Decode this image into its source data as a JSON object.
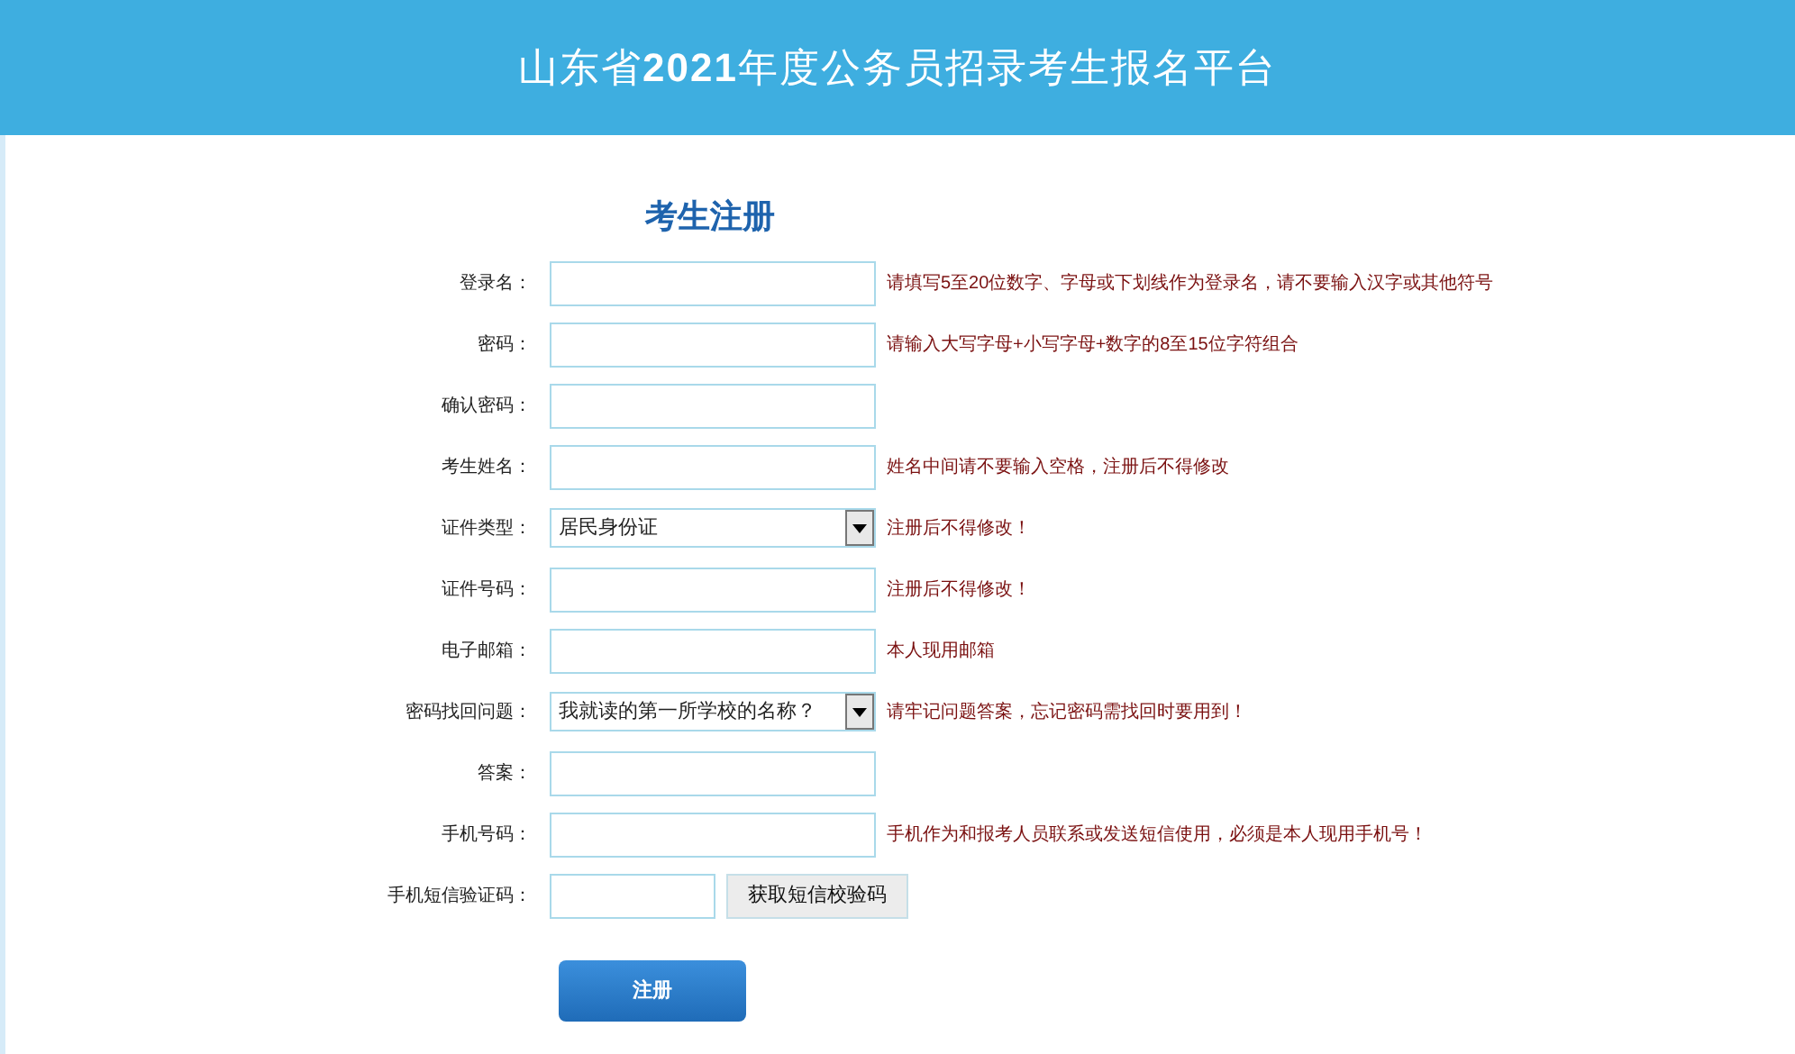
{
  "header": {
    "title": "山东省**2021**年度公务员招录考生报名平台"
  },
  "form": {
    "title": "考生注册",
    "fields": [
      {
        "kind": "text",
        "label": "登录名：",
        "hint": "请填写5至20位数字、字母或下划线作为登录名，请不要输入汉字或其他符号"
      },
      {
        "kind": "text",
        "label": "密码：",
        "hint": "请输入大写字母+小写字母+数字的8至15位字符组合"
      },
      {
        "kind": "text",
        "label": "确认密码："
      },
      {
        "kind": "text",
        "label": "考生姓名：",
        "hint": "姓名中间请不要输入空格，注册后不得修改"
      },
      {
        "kind": "select",
        "label": "证件类型：",
        "value": "居民身份证",
        "hint": "注册后不得修改！"
      },
      {
        "kind": "text",
        "label": "证件号码：",
        "hint": "注册后不得修改！"
      },
      {
        "kind": "text",
        "label": "电子邮箱：",
        "hint": "本人现用邮箱"
      },
      {
        "kind": "select",
        "label": "密码找回问题：",
        "value": "我就读的第一所学校的名称？",
        "hint": "请牢记问题答案，忘记密码需找回时要用到！"
      },
      {
        "kind": "text",
        "label": "答案："
      },
      {
        "kind": "text",
        "label": "手机号码：",
        "hint": "手机作为和报考人员联系或发送短信使用，必须是本人现用手机号！"
      },
      {
        "kind": "code",
        "label": "手机短信验证码：",
        "button": "获取短信校验码"
      }
    ],
    "submit": "注册"
  }
}
